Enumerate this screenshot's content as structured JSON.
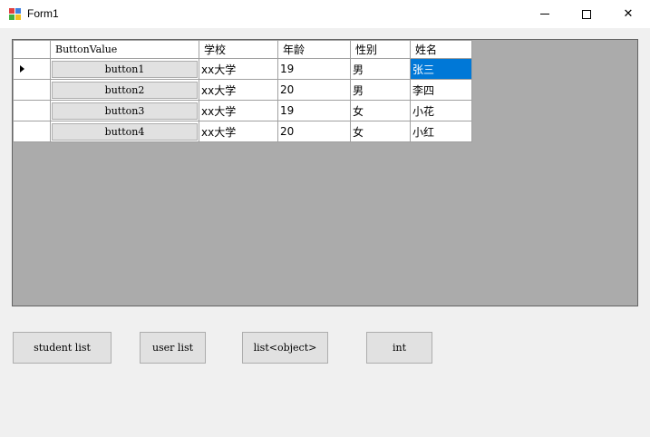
{
  "window": {
    "title": "Form1",
    "icon": "winforms-app-icon",
    "controls": {
      "minimize": "minimize-icon",
      "maximize": "maximize-icon",
      "close": "close-icon"
    },
    "close_glyph": "✕"
  },
  "grid": {
    "columns": [
      "ButtonValue",
      "学校",
      "年龄",
      "性别",
      "姓名"
    ],
    "current_row_indicator": "row-arrow-icon",
    "rows": [
      {
        "button": "button1",
        "school": "xx大学",
        "age": "19",
        "gender": "男",
        "name": "张三"
      },
      {
        "button": "button2",
        "school": "xx大学",
        "age": "20",
        "gender": "男",
        "name": "李四"
      },
      {
        "button": "button3",
        "school": "xx大学",
        "age": "19",
        "gender": "女",
        "name": "小花"
      },
      {
        "button": "button4",
        "school": "xx大学",
        "age": "20",
        "gender": "女",
        "name": "小红"
      }
    ],
    "selection_color": "#0078d7",
    "background_color": "#ababab"
  },
  "buttons": {
    "student_list": "student list",
    "user_list": "user list",
    "list_object": "list<object>",
    "int": "int"
  }
}
